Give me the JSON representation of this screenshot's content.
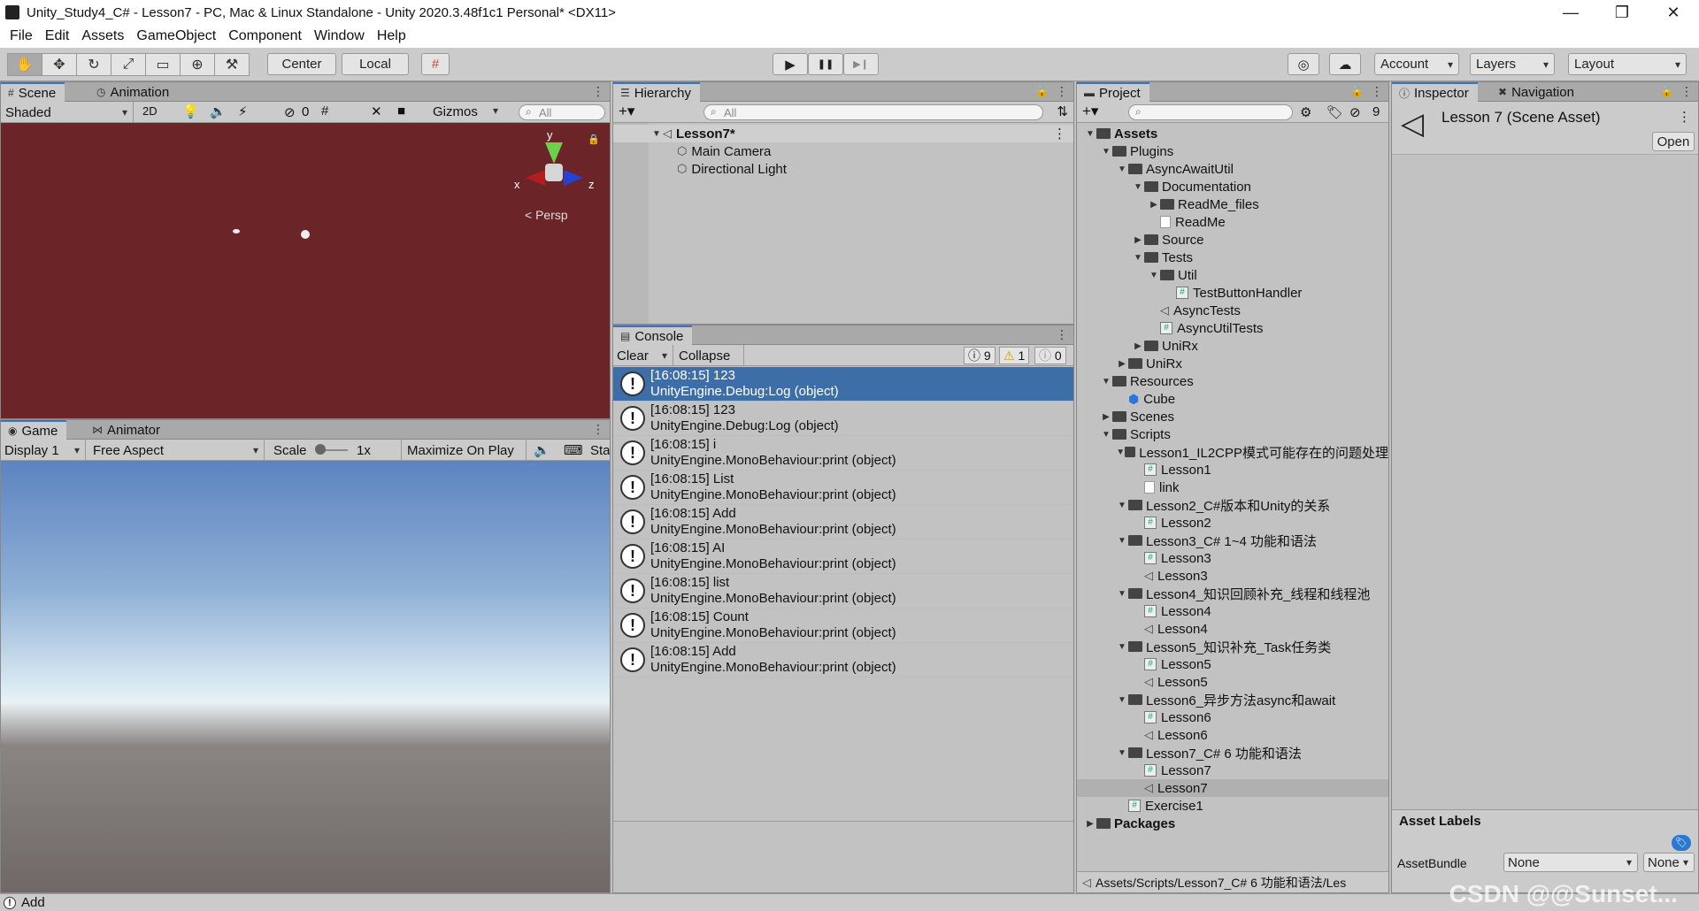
{
  "window": {
    "title": "Unity_Study4_C# - Lesson7 - PC, Mac & Linux Standalone - Unity 2020.3.48f1c1 Personal* <DX11>",
    "controls": [
      "—",
      "❐",
      "✕"
    ]
  },
  "menu": [
    "File",
    "Edit",
    "Assets",
    "GameObject",
    "Component",
    "Window",
    "Help"
  ],
  "toolbar": {
    "tools": [
      "✋",
      "✥",
      "↻",
      "⤢",
      "▭",
      "⊕",
      "⚒"
    ],
    "pivot": "Center",
    "space": "Local",
    "play": "▶",
    "pause": "❚❚",
    "step": "▶❙",
    "account": "Account",
    "layers": "Layers",
    "layout": "Layout"
  },
  "scene": {
    "tabs": [
      "Scene",
      "Animation"
    ],
    "shading": "Shaded",
    "mode2d": "2D",
    "hidden_count": "0",
    "gizmos": "Gizmos",
    "search_placeholder": "All",
    "axis_y": "y",
    "axis_x": "x",
    "axis_z": "z",
    "persp": "< Persp"
  },
  "game": {
    "tabs": [
      "Game",
      "Animator"
    ],
    "display": "Display 1",
    "aspect": "Free Aspect",
    "scale_label": "Scale",
    "scale_value": "1x",
    "maximize": "Maximize On Play",
    "stats": "Sta"
  },
  "hierarchy": {
    "tab": "Hierarchy",
    "search_placeholder": "All",
    "scene_name": "Lesson7*",
    "items": [
      "Main Camera",
      "Directional Light"
    ]
  },
  "console": {
    "tab": "Console",
    "clear": "Clear",
    "collapse": "Collapse",
    "log_count": "9",
    "warn_count": "1",
    "error_count": "0",
    "entries": [
      {
        "line1": "[16:08:15] 123",
        "line2": "UnityEngine.Debug:Log (object)"
      },
      {
        "line1": "[16:08:15] 123",
        "line2": "UnityEngine.Debug:Log (object)"
      },
      {
        "line1": "[16:08:15] i",
        "line2": "UnityEngine.MonoBehaviour:print (object)"
      },
      {
        "line1": "[16:08:15] List",
        "line2": "UnityEngine.MonoBehaviour:print (object)"
      },
      {
        "line1": "[16:08:15] Add",
        "line2": "UnityEngine.MonoBehaviour:print (object)"
      },
      {
        "line1": "[16:08:15] AI",
        "line2": "UnityEngine.MonoBehaviour:print (object)"
      },
      {
        "line1": "[16:08:15] list",
        "line2": "UnityEngine.MonoBehaviour:print (object)"
      },
      {
        "line1": "[16:08:15] Count",
        "line2": "UnityEngine.MonoBehaviour:print (object)"
      },
      {
        "line1": "[16:08:15] Add",
        "line2": "UnityEngine.MonoBehaviour:print (object)"
      }
    ]
  },
  "project": {
    "tab": "Project",
    "hidden_count": "9",
    "path": "Assets/Scripts/Lesson7_C# 6 功能和语法/Les",
    "tree": [
      {
        "label": "Assets",
        "depth": 0,
        "arrow": "▼",
        "icon": "folder",
        "bold": true
      },
      {
        "label": "Plugins",
        "depth": 1,
        "arrow": "▼",
        "icon": "folder"
      },
      {
        "label": "AsyncAwaitUtil",
        "depth": 2,
        "arrow": "▼",
        "icon": "folder"
      },
      {
        "label": "Documentation",
        "depth": 3,
        "arrow": "▼",
        "icon": "folder"
      },
      {
        "label": "ReadMe_files",
        "depth": 4,
        "arrow": "▶",
        "icon": "folder"
      },
      {
        "label": "ReadMe",
        "depth": 4,
        "arrow": "",
        "icon": "text"
      },
      {
        "label": "Source",
        "depth": 3,
        "arrow": "▶",
        "icon": "folder"
      },
      {
        "label": "Tests",
        "depth": 3,
        "arrow": "▼",
        "icon": "folder"
      },
      {
        "label": "Util",
        "depth": 4,
        "arrow": "▼",
        "icon": "folder"
      },
      {
        "label": "TestButtonHandler",
        "depth": 5,
        "arrow": "",
        "icon": "cs"
      },
      {
        "label": "AsyncTests",
        "depth": 4,
        "arrow": "",
        "icon": "scene"
      },
      {
        "label": "AsyncUtilTests",
        "depth": 4,
        "arrow": "",
        "icon": "cs"
      },
      {
        "label": "UniRx",
        "depth": 3,
        "arrow": "▶",
        "icon": "folder"
      },
      {
        "label": "UniRx",
        "depth": 2,
        "arrow": "▶",
        "icon": "folder"
      },
      {
        "label": "Resources",
        "depth": 1,
        "arrow": "▼",
        "icon": "folder"
      },
      {
        "label": "Cube",
        "depth": 2,
        "arrow": "",
        "icon": "cube"
      },
      {
        "label": "Scenes",
        "depth": 1,
        "arrow": "▶",
        "icon": "folder"
      },
      {
        "label": "Scripts",
        "depth": 1,
        "arrow": "▼",
        "icon": "folder"
      },
      {
        "label": "Lesson1_IL2CPP模式可能存在的问题处理",
        "depth": 2,
        "arrow": "▼",
        "icon": "folder"
      },
      {
        "label": "Lesson1",
        "depth": 3,
        "arrow": "",
        "icon": "cs"
      },
      {
        "label": "link",
        "depth": 3,
        "arrow": "",
        "icon": "text"
      },
      {
        "label": "Lesson2_C#版本和Unity的关系",
        "depth": 2,
        "arrow": "▼",
        "icon": "folder"
      },
      {
        "label": "Lesson2",
        "depth": 3,
        "arrow": "",
        "icon": "cs"
      },
      {
        "label": "Lesson3_C# 1~4 功能和语法",
        "depth": 2,
        "arrow": "▼",
        "icon": "folder"
      },
      {
        "label": "Lesson3",
        "depth": 3,
        "arrow": "",
        "icon": "cs"
      },
      {
        "label": "Lesson3",
        "depth": 3,
        "arrow": "",
        "icon": "scene"
      },
      {
        "label": "Lesson4_知识回顾补充_线程和线程池",
        "depth": 2,
        "arrow": "▼",
        "icon": "folder"
      },
      {
        "label": "Lesson4",
        "depth": 3,
        "arrow": "",
        "icon": "cs"
      },
      {
        "label": "Lesson4",
        "depth": 3,
        "arrow": "",
        "icon": "scene"
      },
      {
        "label": "Lesson5_知识补充_Task任务类",
        "depth": 2,
        "arrow": "▼",
        "icon": "folder"
      },
      {
        "label": "Lesson5",
        "depth": 3,
        "arrow": "",
        "icon": "cs"
      },
      {
        "label": "Lesson5",
        "depth": 3,
        "arrow": "",
        "icon": "scene"
      },
      {
        "label": "Lesson6_异步方法async和await",
        "depth": 2,
        "arrow": "▼",
        "icon": "folder"
      },
      {
        "label": "Lesson6",
        "depth": 3,
        "arrow": "",
        "icon": "cs"
      },
      {
        "label": "Lesson6",
        "depth": 3,
        "arrow": "",
        "icon": "scene"
      },
      {
        "label": "Lesson7_C# 6 功能和语法",
        "depth": 2,
        "arrow": "▼",
        "icon": "folder"
      },
      {
        "label": "Lesson7",
        "depth": 3,
        "arrow": "",
        "icon": "cs"
      },
      {
        "label": "Lesson7",
        "depth": 3,
        "arrow": "",
        "icon": "scene",
        "selected": true
      },
      {
        "label": "Exercise1",
        "depth": 2,
        "arrow": "",
        "icon": "cs"
      },
      {
        "label": "Packages",
        "depth": 0,
        "arrow": "▶",
        "icon": "folder",
        "bold": true
      }
    ]
  },
  "inspector": {
    "tabs": [
      "Inspector",
      "Navigation"
    ],
    "asset_title": "Lesson 7 (Scene Asset)",
    "open_button": "Open",
    "asset_labels": "Asset Labels",
    "asset_bundle_label": "AssetBundle",
    "bundle_value": "None",
    "variant_value": "None"
  },
  "status": {
    "text": "Add",
    "watermark": "CSDN @@Sunset..."
  }
}
